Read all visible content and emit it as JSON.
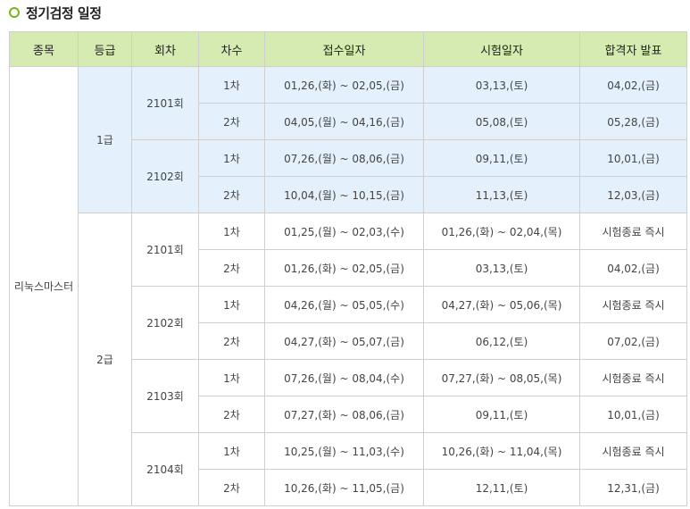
{
  "page_title": "정기검정 일정",
  "headers": [
    "종목",
    "등급",
    "회차",
    "차수",
    "접수일자",
    "시험일자",
    "합격자 발표"
  ],
  "subject": "리눅스마스터",
  "grades": [
    {
      "name": "1급",
      "sessions": [
        {
          "name": "2101회",
          "rounds": [
            {
              "round": "1차",
              "apply": "01,26,(화) ~ 02,05,(금)",
              "exam": "03,13,(토)",
              "result": "04,02,(금)"
            },
            {
              "round": "2차",
              "apply": "04,05,(월) ~ 04,16,(금)",
              "exam": "05,08,(토)",
              "result": "05,28,(금)"
            }
          ]
        },
        {
          "name": "2102회",
          "rounds": [
            {
              "round": "1차",
              "apply": "07,26,(월) ~ 08,06,(금)",
              "exam": "09,11,(토)",
              "result": "10,01,(금)"
            },
            {
              "round": "2차",
              "apply": "10,04,(월) ~ 10,15,(금)",
              "exam": "11,13,(토)",
              "result": "12,03,(금)"
            }
          ]
        }
      ]
    },
    {
      "name": "2급",
      "sessions": [
        {
          "name": "2101회",
          "rounds": [
            {
              "round": "1차",
              "apply": "01,25,(월) ~ 02,03,(수)",
              "exam": "01,26,(화) ~ 02,04,(목)",
              "result": "시험종료 즉시"
            },
            {
              "round": "2차",
              "apply": "01,26,(화) ~ 02,05,(금)",
              "exam": "03,13,(토)",
              "result": "04,02,(금)"
            }
          ]
        },
        {
          "name": "2102회",
          "rounds": [
            {
              "round": "1차",
              "apply": "04,26,(월) ~ 05,05,(수)",
              "exam": "04,27,(화) ~ 05,06,(목)",
              "result": "시험종료 즉시"
            },
            {
              "round": "2차",
              "apply": "04,27,(화) ~ 05,07,(금)",
              "exam": "06,12,(토)",
              "result": "07,02,(금)"
            }
          ]
        },
        {
          "name": "2103회",
          "rounds": [
            {
              "round": "1차",
              "apply": "07,26,(월) ~ 08,04,(수)",
              "exam": "07,27,(화) ~ 08,05,(목)",
              "result": "시험종료 즉시"
            },
            {
              "round": "2차",
              "apply": "07,27,(화) ~ 08,06,(금)",
              "exam": "09,11,(토)",
              "result": "10,01,(금)"
            }
          ]
        },
        {
          "name": "2104회",
          "rounds": [
            {
              "round": "1차",
              "apply": "10,25,(월) ~ 11,03,(수)",
              "exam": "10,26,(화) ~ 11,04,(목)",
              "result": "시험종료 즉시"
            },
            {
              "round": "2차",
              "apply": "10,26,(화) ~ 11,05,(금)",
              "exam": "12,11,(토)",
              "result": "12,31,(금)"
            }
          ]
        }
      ]
    }
  ],
  "colors": {
    "header_bg": "#d5ebb1",
    "grade1_bg": "#e4f1fc",
    "bullet": "#7ab51d",
    "border": "#cfcfcf"
  }
}
